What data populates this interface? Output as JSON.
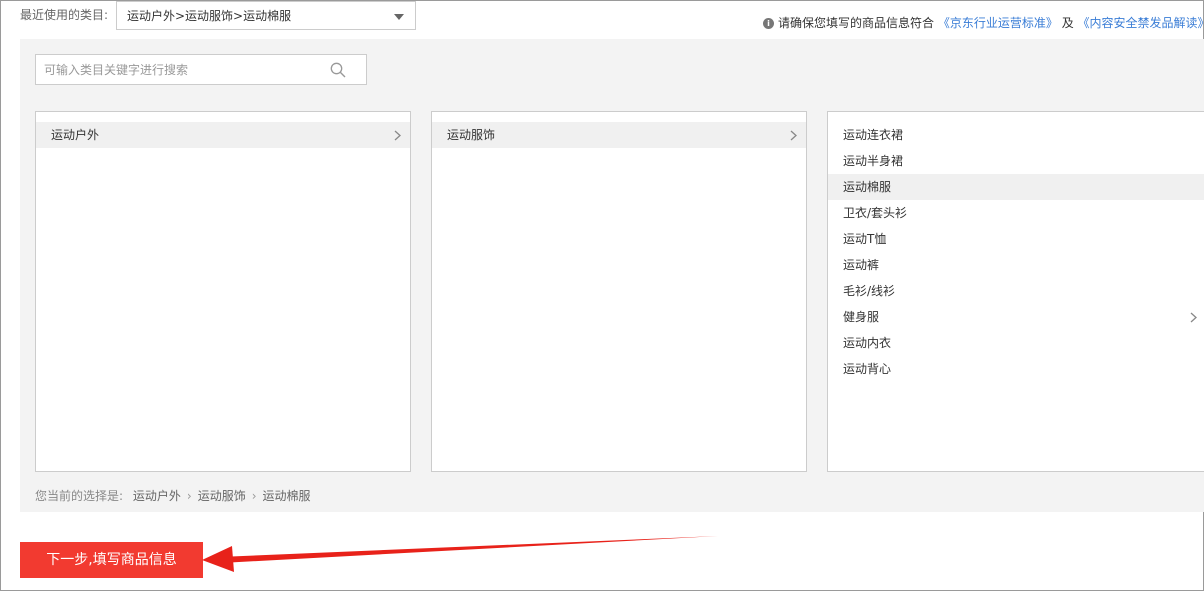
{
  "recent": {
    "label": "最近使用的类目:",
    "selected": "运动户外>运动服饰>运动棉服"
  },
  "notice": {
    "text": "请确保您填写的商品信息符合",
    "link1": "《京东行业运营标准》",
    "and": "及",
    "link2": "《内容安全禁发品解读》"
  },
  "search": {
    "placeholder": "可输入类目关键字进行搜索"
  },
  "columns": {
    "level1": [
      {
        "label": "运动户外"
      }
    ],
    "level2": [
      {
        "label": "运动服饰"
      }
    ],
    "level3": [
      {
        "label": "运动连衣裙"
      },
      {
        "label": "运动半身裙"
      },
      {
        "label": "运动棉服"
      },
      {
        "label": "卫衣/套头衫"
      },
      {
        "label": "运动T恤"
      },
      {
        "label": "运动裤"
      },
      {
        "label": "毛衫/线衫"
      },
      {
        "label": "健身服"
      },
      {
        "label": "运动内衣"
      },
      {
        "label": "运动背心"
      }
    ]
  },
  "current": {
    "label": "您当前的选择是:",
    "path": [
      "运动户外",
      "运动服饰",
      "运动棉服"
    ]
  },
  "next_button": "下一步,填写商品信息",
  "colors": {
    "accent": "#f23a30",
    "link": "#3a7dd6",
    "annotation_arrow": "#e8221a"
  }
}
